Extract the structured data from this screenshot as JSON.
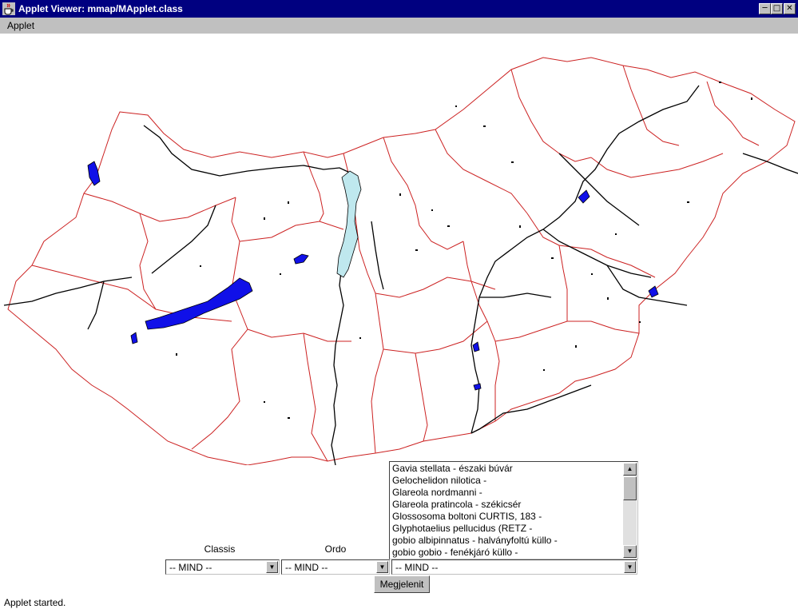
{
  "window": {
    "title": "Applet Viewer: mmap/MApplet.class",
    "controls": [
      "minimize-icon",
      "maximize-icon",
      "close-icon"
    ]
  },
  "menu": {
    "items": [
      "Applet"
    ]
  },
  "map": {
    "colors": {
      "border": "#cc2222",
      "river": "#000000",
      "lake": "#0000ee",
      "danube_lake": "#bfe8ee"
    }
  },
  "filters": {
    "classis_label": "Classis",
    "ordo_label": "Ordo",
    "classis_value": "-- MIND --",
    "ordo_value": "-- MIND --",
    "species_value": "-- MIND --"
  },
  "species_list": [
    "Gavia stellata - északi búvár",
    "Gelochelidon nilotica -",
    "Glareola nordmanni -",
    "Glareola pratincola - székicsér",
    "Glossosoma boltoni CURTIS, 183 -",
    "Glyphotaelius pellucidus (RETZ -",
    "gobio albipinnatus - halványfoltú küllo -",
    "gobio gobio - fenékjáró küllo -"
  ],
  "actions": {
    "display_label": "Megjelenit"
  },
  "status": {
    "text": "Applet started."
  },
  "colors": {
    "titlebar": "#000080",
    "chrome": "#c0c0c0"
  }
}
